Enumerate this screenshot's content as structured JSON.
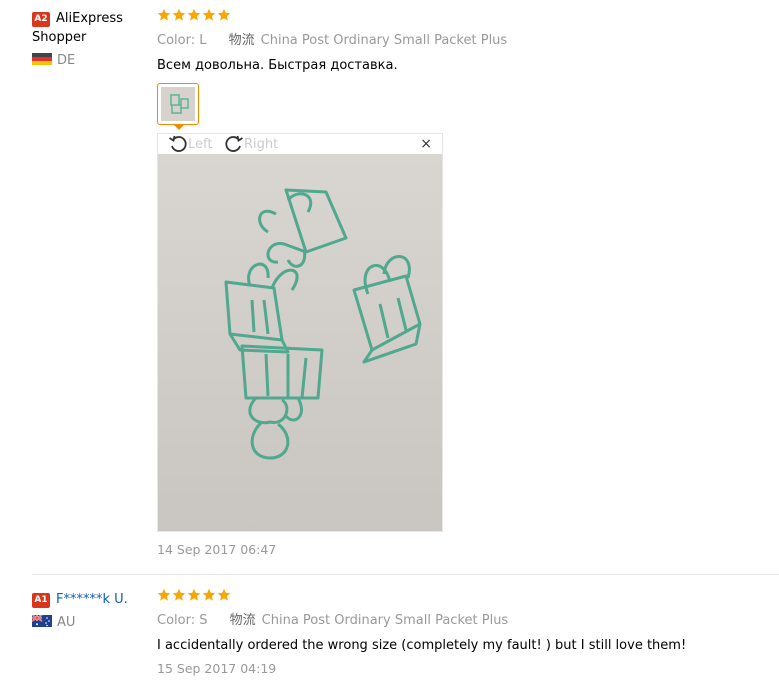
{
  "reviews": [
    {
      "level": "A2",
      "user_name": "AliExpress Shopper",
      "country": "DE",
      "rating": 5,
      "color_label": "Color:",
      "color_value": "L",
      "logistics_label": "物流",
      "logistics_value": "China Post Ordinary Small Packet Plus",
      "text": "Всем довольна. Быстрая доставка.",
      "date": "14 Sep 2017 06:47",
      "viewer": {
        "rotate_left": "Left",
        "rotate_right": "Right",
        "close": "×"
      }
    },
    {
      "level": "A1",
      "user_name": "F******k U.",
      "country": "AU",
      "rating": 5,
      "color_label": "Color:",
      "color_value": "S",
      "logistics_label": "物流",
      "logistics_value": "China Post Ordinary Small Packet Plus",
      "text": "I accidentally ordered the wrong size (completely my fault! ) but I still love them!",
      "date": "15 Sep 2017 04:19"
    }
  ],
  "colors": {
    "star": "#f7a700",
    "badge": "#d9361c",
    "link": "#0e5fb4",
    "thumb_border": "#f08a00"
  }
}
